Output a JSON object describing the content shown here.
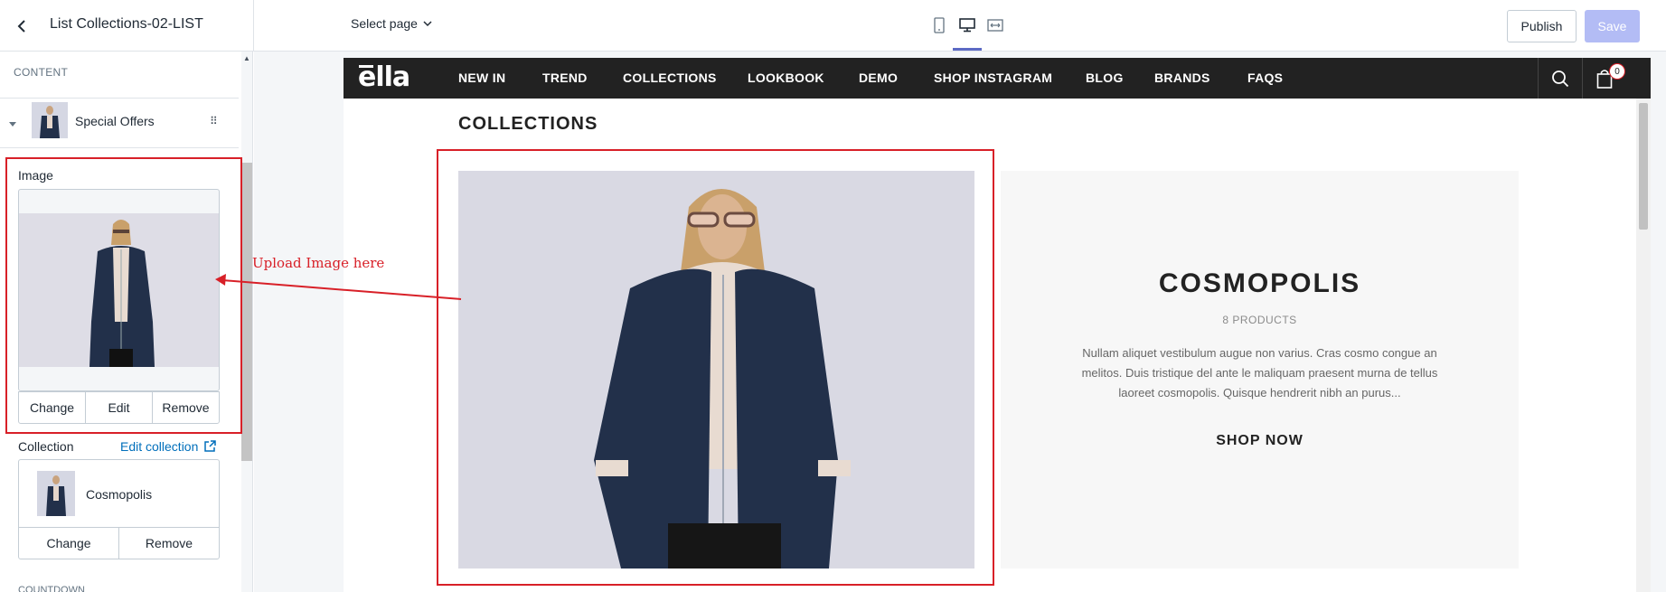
{
  "header": {
    "theme_title": "List Collections-02-LIST",
    "select_page": "Select page",
    "publish_label": "Publish",
    "save_label": "Save"
  },
  "sidebar": {
    "section_label": "CONTENT",
    "block_title": "Special Offers",
    "image_label": "Image",
    "image_buttons": [
      "Change",
      "Edit",
      "Remove"
    ],
    "collection_label": "Collection",
    "edit_collection": "Edit collection",
    "collection_name": "Cosmopolis",
    "collection_buttons": [
      "Change",
      "Remove"
    ],
    "next_section": "COUNTDOWN"
  },
  "annotation": {
    "text": "Upload Image here",
    "color": "#d82028"
  },
  "store": {
    "logo": "ella",
    "nav": [
      "NEW IN",
      "TREND",
      "COLLECTIONS",
      "LOOKBOOK",
      "DEMO",
      "SHOP INSTAGRAM",
      "BLOG",
      "BRANDS",
      "FAQS"
    ],
    "cart_count": "0",
    "section_heading": "COLLECTIONS",
    "hero": {
      "title": "COSMOPOLIS",
      "count": "8 PRODUCTS",
      "description": "Nullam aliquet vestibulum augue non varius. Cras cosmo congue an melitos. Duis tristique del ante le maliquam praesent murna de tellus laoreet cosmopolis. Quisque hendrerit nibh an purus...",
      "cta": "SHOP NOW"
    }
  },
  "icons": {
    "back": "chevron-left-icon",
    "mobile": "mobile-icon",
    "desktop": "desktop-icon",
    "fullwidth": "fullwidth-icon",
    "search": "search-icon",
    "cart": "shopping-bag-icon"
  },
  "colors": {
    "accent": "#5c6ac4",
    "link": "#006fbb",
    "save_disabled": "#b3bcf5",
    "store_nav": "#222222"
  }
}
